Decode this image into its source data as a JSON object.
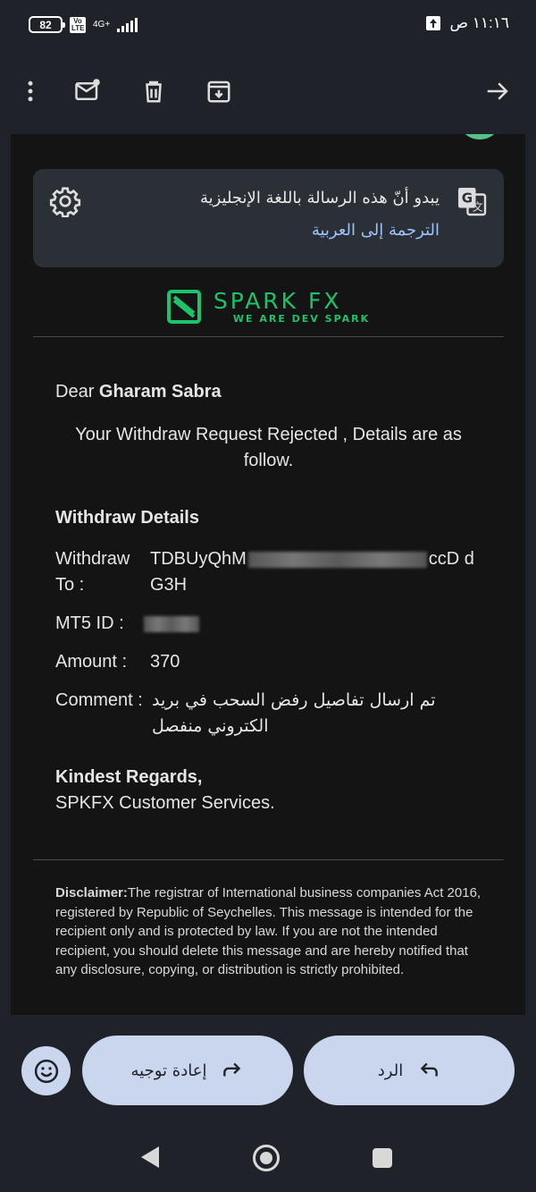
{
  "status_bar": {
    "battery": "82",
    "volte_label": "Vo LTE",
    "network": "4G+",
    "time": "١١:١٦ ص"
  },
  "toolbar": {
    "icons": [
      "more-vert-icon",
      "mark-unread-icon",
      "delete-icon",
      "archive-icon",
      "forward-arrow-icon"
    ]
  },
  "translate_banner": {
    "message": "يبدو أنّ هذه الرسالة باللغة الإنجليزية",
    "link": "الترجمة إلى العربية"
  },
  "email": {
    "logo": {
      "main": "SPARK FX",
      "tagline": "WE ARE DEV SPARK"
    },
    "greeting_prefix": "Dear ",
    "recipient": "Gharam Sabra",
    "intro": "Your Withdraw Request Rejected , Details are as follow.",
    "section_title": "Withdraw Details",
    "details": {
      "to_label": "Withdraw To :",
      "to_value_start": "TDBUyQhM",
      "to_value_end": "ccD dG3H",
      "mt5_label": "MT5 ID :",
      "amount_label": "Amount :",
      "amount_value": "370",
      "comment_label": "Comment :",
      "comment_value": "تم ارسال تفاصيل رفض السحب في بريد الكتروني منفصل"
    },
    "regards": "Kindest Regards,",
    "signature": "SPKFX Customer Services.",
    "disclaimer_label": "Disclaimer:",
    "disclaimer_text": "The registrar of International business companies Act 2016, registered by Republic of Seychelles. This message is intended for the recipient only and is protected by law. If you are not the intended recipient, you should delete this message and are hereby notified that any disclosure, copying, or distribution is strictly prohibited."
  },
  "actions": {
    "forward_label": "إعادة توجيه",
    "reply_label": "الرد"
  },
  "colors": {
    "accent_green": "#1cc36a",
    "pill_bg": "#c9d6ee",
    "link_blue": "#9ec3ff"
  }
}
